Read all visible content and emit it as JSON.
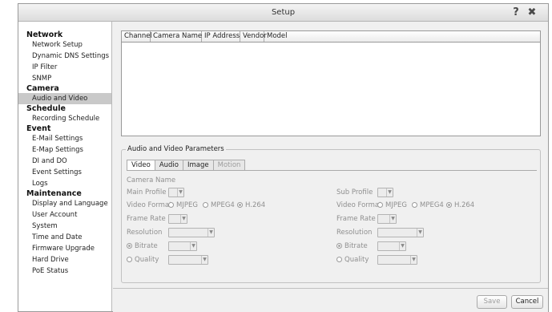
{
  "window": {
    "title": "Setup"
  },
  "titlebar_icons": {
    "help": "?",
    "close": "✖"
  },
  "sidebar": {
    "groups": [
      {
        "label": "Network",
        "items": [
          "Network Setup",
          "Dynamic DNS Settings",
          "IP Filter",
          "SNMP"
        ]
      },
      {
        "label": "Camera",
        "items": [
          "Audio and Video"
        ]
      },
      {
        "label": "Schedule",
        "items": [
          "Recording Schedule"
        ]
      },
      {
        "label": "Event",
        "items": [
          "E-Mail Settings",
          "E-Map Settings",
          "DI and DO",
          "Event Settings",
          "Logs"
        ]
      },
      {
        "label": "Maintenance",
        "items": [
          "Display and Language",
          "User Account",
          "System",
          "Time and Date",
          "Firmware Upgrade",
          "Hard Drive",
          "PoE Status"
        ]
      }
    ],
    "selected": "Audio and Video"
  },
  "camera_table": {
    "columns": [
      "Channel",
      "Camera Name",
      "IP Address",
      "Vendor",
      "Model"
    ],
    "rows": []
  },
  "av_panel": {
    "legend": "Audio and Video Parameters",
    "tabs": [
      {
        "label": "Video",
        "state": "active"
      },
      {
        "label": "Audio",
        "state": "normal"
      },
      {
        "label": "Image",
        "state": "normal"
      },
      {
        "label": "Motion",
        "state": "disabled"
      }
    ],
    "camera_name_label": "Camera Name",
    "main": {
      "profile_label": "Main Profile",
      "video_format_label": "Video Format",
      "formats": [
        "MJPEG",
        "MPEG4",
        "H.264"
      ],
      "selected_format": "H.264",
      "frame_rate_label": "Frame Rate",
      "resolution_label": "Resolution",
      "bitrate_label": "Bitrate",
      "quality_label": "Quality"
    },
    "sub": {
      "profile_label": "Sub Profile",
      "video_format_label": "Video Format",
      "formats": [
        "MJPEG",
        "MPEG4",
        "H.264"
      ],
      "selected_format": "H.264",
      "frame_rate_label": "Frame Rate",
      "resolution_label": "Resolution",
      "bitrate_label": "Bitrate",
      "quality_label": "Quality"
    },
    "rate_mode_selected": "Bitrate"
  },
  "footer": {
    "save_label": "Save",
    "cancel_label": "Cancel"
  },
  "colors": {
    "selected_bg": "#c9c9c9",
    "disabled_text": "#8f8f8f",
    "border": "#999999"
  }
}
